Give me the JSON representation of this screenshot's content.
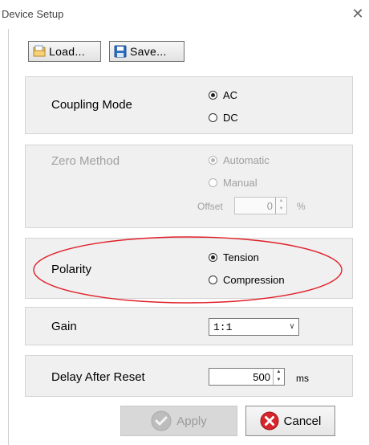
{
  "window": {
    "title": "Device Setup",
    "close_icon": "close-icon"
  },
  "toolbar": {
    "load_label": "Load...",
    "save_label": "Save..."
  },
  "coupling": {
    "label": "Coupling Mode",
    "options": [
      "AC",
      "DC"
    ],
    "selected": "AC"
  },
  "zero": {
    "label": "Zero Method",
    "options": [
      "Automatic",
      "Manual"
    ],
    "selected": "Automatic",
    "offset_label": "Offset",
    "offset_value": "0",
    "offset_unit": "%",
    "enabled": false
  },
  "polarity": {
    "label": "Polarity",
    "options": [
      "Tension",
      "Compression"
    ],
    "selected": "Tension",
    "highlight_color": "#e0202a"
  },
  "gain": {
    "label": "Gain",
    "value": "1:1"
  },
  "delay": {
    "label": "Delay After Reset",
    "value": "500",
    "unit": "ms"
  },
  "buttons": {
    "apply_label": "Apply",
    "cancel_label": "Cancel",
    "apply_enabled": false
  }
}
